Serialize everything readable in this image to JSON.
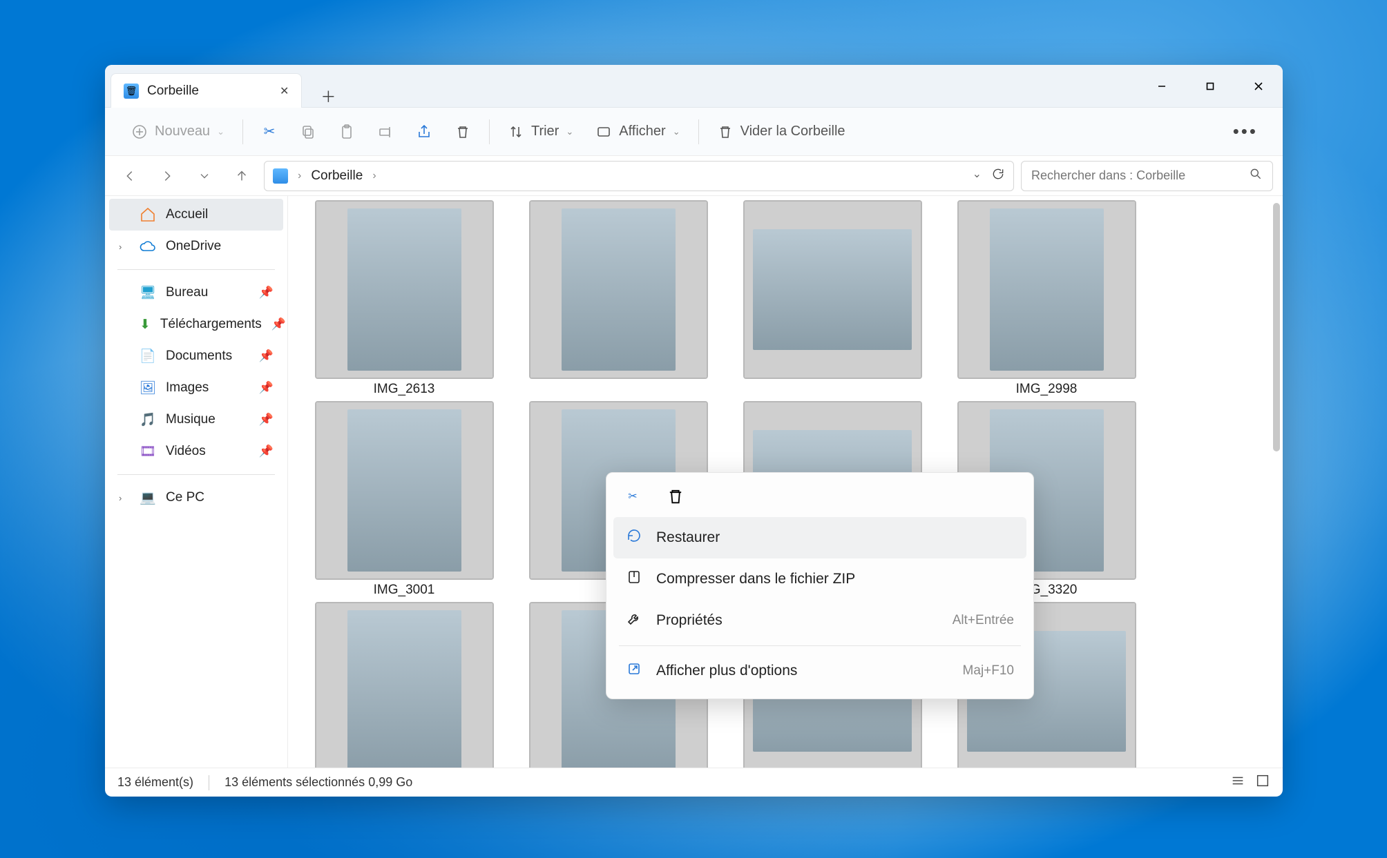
{
  "tab": {
    "title": "Corbeille"
  },
  "toolbar": {
    "new": "Nouveau",
    "sort": "Trier",
    "view": "Afficher",
    "empty": "Vider la Corbeille"
  },
  "breadcrumb": {
    "location": "Corbeille"
  },
  "search": {
    "placeholder": "Rechercher dans : Corbeille"
  },
  "sidebar": {
    "home": "Accueil",
    "onedrive": "OneDrive",
    "desktop": "Bureau",
    "downloads": "Téléchargements",
    "documents": "Documents",
    "pictures": "Images",
    "music": "Musique",
    "videos": "Vidéos",
    "thispc": "Ce PC"
  },
  "files": [
    {
      "name": "IMG_2613"
    },
    {
      "name": ""
    },
    {
      "name": ""
    },
    {
      "name": "IMG_2998"
    },
    {
      "name": "IMG_3001"
    },
    {
      "name": ""
    },
    {
      "name": ""
    },
    {
      "name": "IMG_3320"
    }
  ],
  "context_menu": {
    "restore": "Restaurer",
    "compress": "Compresser dans le fichier ZIP",
    "properties": "Propriétés",
    "properties_shortcut": "Alt+Entrée",
    "more": "Afficher plus d'options",
    "more_shortcut": "Maj+F10"
  },
  "status": {
    "count": "13 élément(s)",
    "selection": "13 éléments sélectionnés  0,99 Go"
  }
}
